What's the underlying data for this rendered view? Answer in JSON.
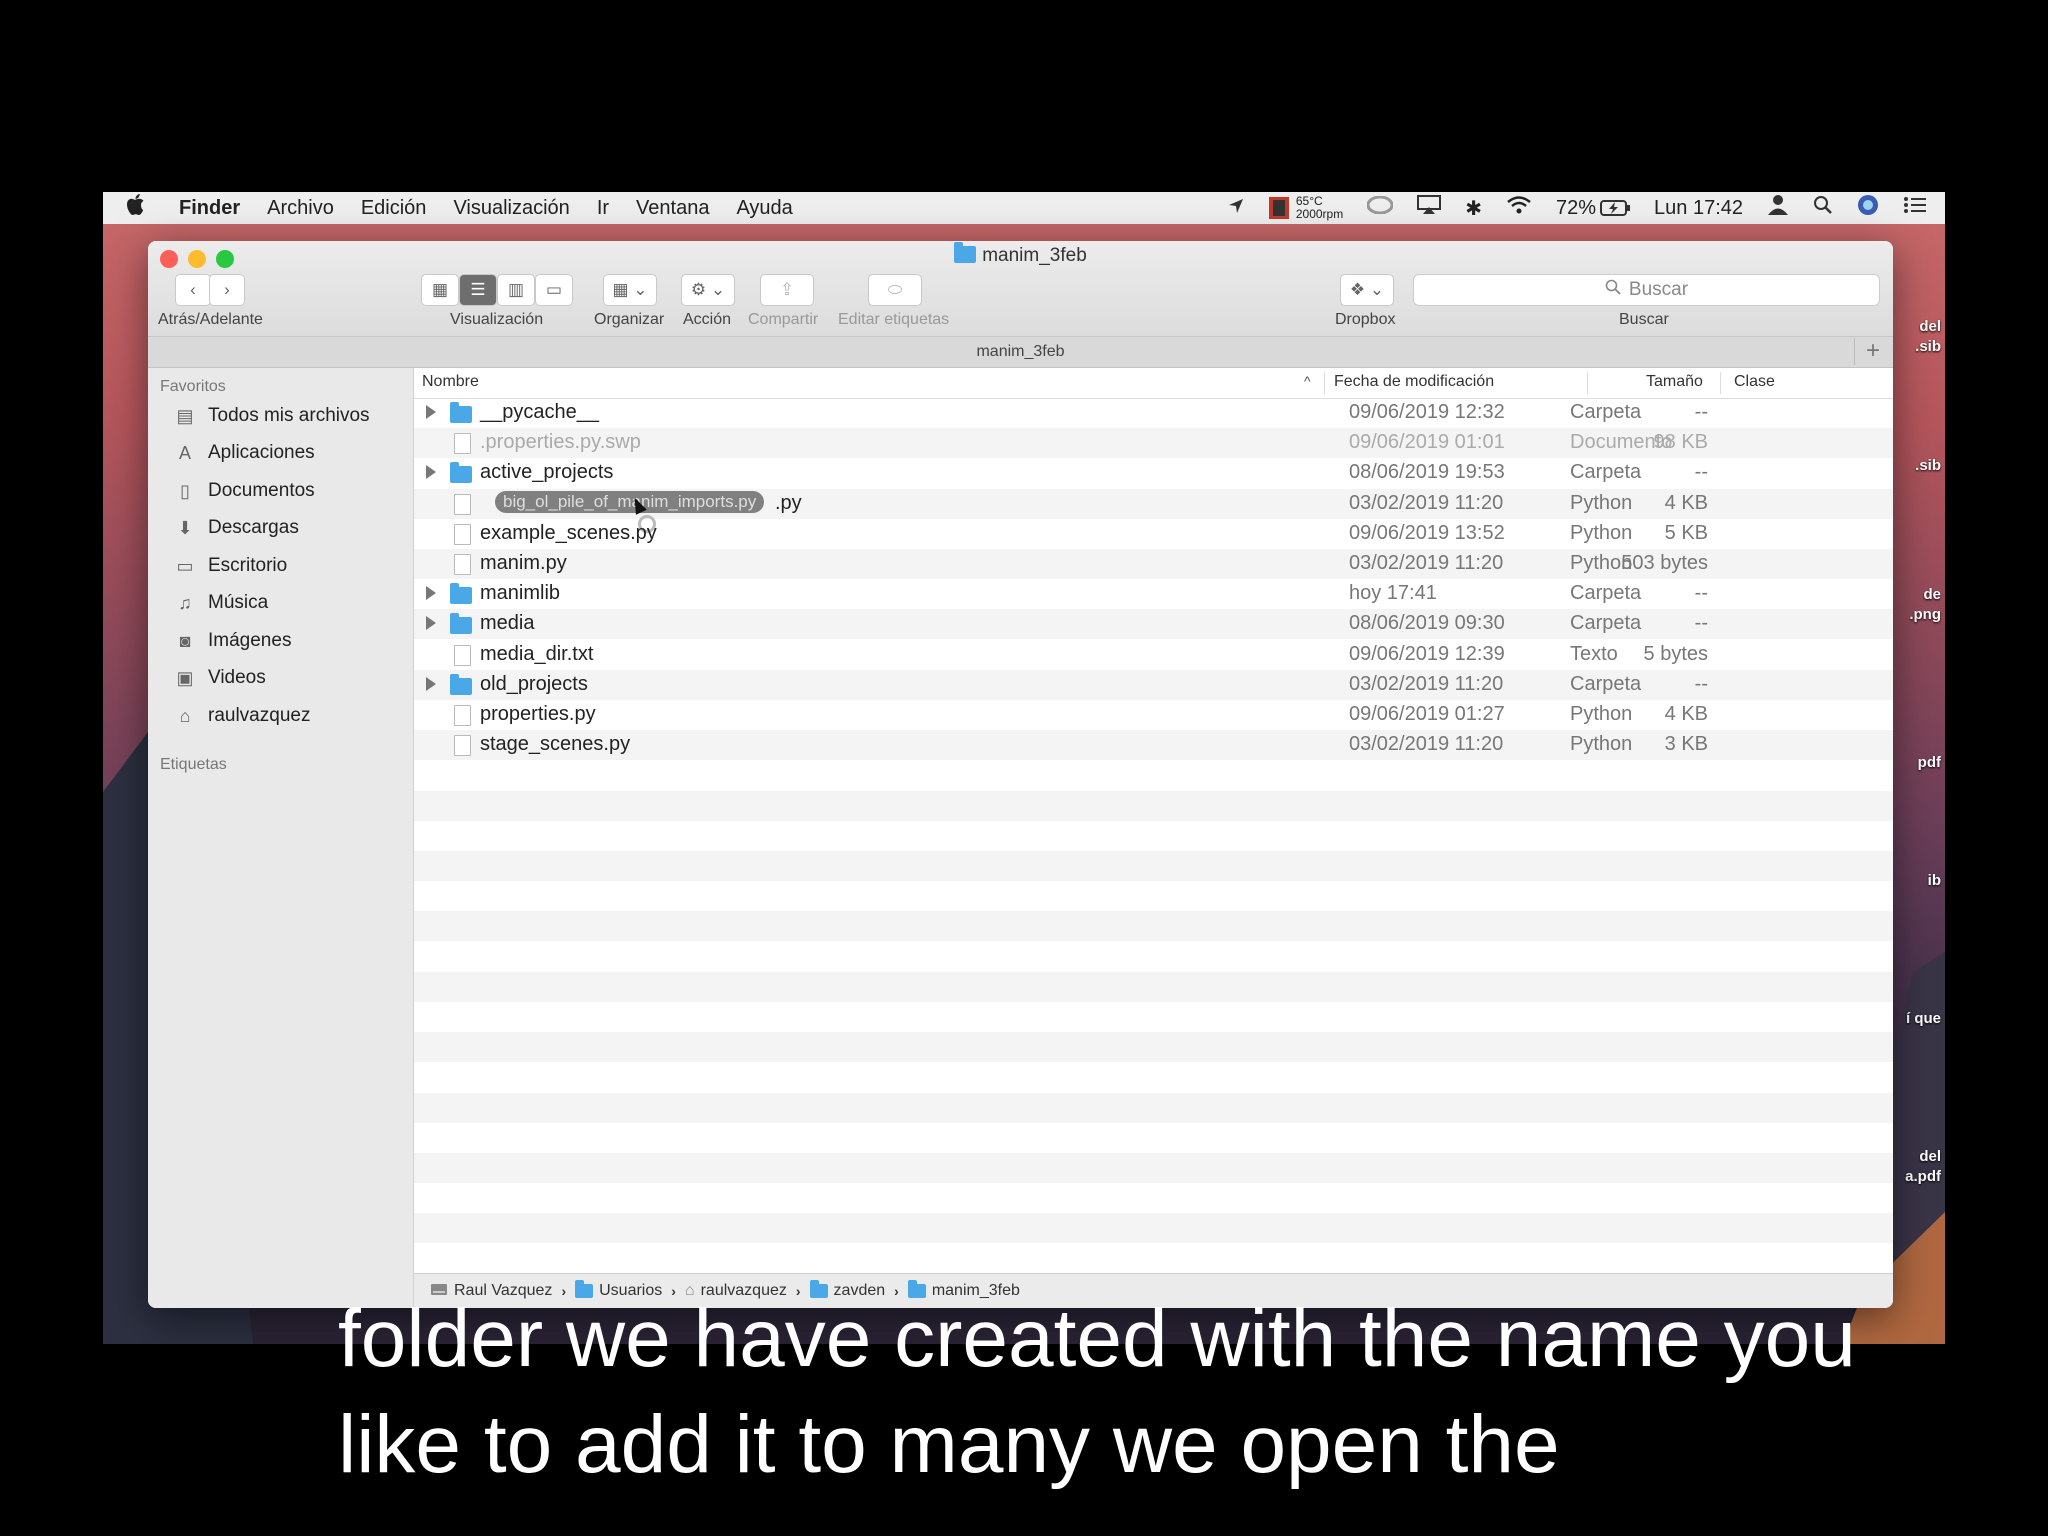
{
  "menubar": {
    "apple": "",
    "items": [
      "Finder",
      "Archivo",
      "Edición",
      "Visualización",
      "Ir",
      "Ventana",
      "Ayuda"
    ],
    "temp": "65°C",
    "rpm": "2000rpm",
    "battery": "72%",
    "clock": "Lun 17:42"
  },
  "window": {
    "title": "manim_3feb",
    "path_title": "manim_3feb"
  },
  "toolbar": {
    "back_forward_label": "Atrás/Adelante",
    "view_label": "Visualización",
    "arrange_label": "Organizar",
    "action_label": "Acción",
    "share_label": "Compartir",
    "tags_label": "Editar etiquetas",
    "dropbox_label": "Dropbox",
    "search_label": "Buscar",
    "search_placeholder": "Buscar"
  },
  "sidebar": {
    "favorites_header": "Favoritos",
    "tags_header": "Etiquetas",
    "items": [
      {
        "label": "Todos mis archivos",
        "icon": "all-files-icon"
      },
      {
        "label": "Aplicaciones",
        "icon": "applications-icon"
      },
      {
        "label": "Documentos",
        "icon": "documents-icon"
      },
      {
        "label": "Descargas",
        "icon": "downloads-icon"
      },
      {
        "label": "Escritorio",
        "icon": "desktop-icon"
      },
      {
        "label": "Música",
        "icon": "music-icon"
      },
      {
        "label": "Imágenes",
        "icon": "pictures-icon"
      },
      {
        "label": "Videos",
        "icon": "movies-icon"
      },
      {
        "label": "raulvazquez",
        "icon": "home-icon"
      }
    ]
  },
  "columns": {
    "name": "Nombre",
    "date": "Fecha de modificación",
    "size": "Tamaño",
    "kind": "Clase"
  },
  "files": [
    {
      "name": "__pycache__",
      "date": "09/06/2019 12:32",
      "size": "--",
      "kind": "Carpeta",
      "folder": true
    },
    {
      "name": ".properties.py.swp",
      "date": "09/06/2019 01:01",
      "size": "98 KB",
      "kind": "Documento",
      "folder": false,
      "dim": true
    },
    {
      "name": "active_projects",
      "date": "08/06/2019 19:53",
      "size": "--",
      "kind": "Carpeta",
      "folder": true
    },
    {
      "name": "big_ol_pile_of_manim_imports.py",
      "date": "03/02/2019 11:20",
      "size": "4 KB",
      "kind": "Python",
      "folder": false
    },
    {
      "name": "example_scenes.py",
      "date": "09/06/2019 13:52",
      "size": "5 KB",
      "kind": "Python",
      "folder": false
    },
    {
      "name": "manim.py",
      "date": "03/02/2019 11:20",
      "size": "503 bytes",
      "kind": "Python",
      "folder": false
    },
    {
      "name": "manimlib",
      "date": "hoy 17:41",
      "size": "--",
      "kind": "Carpeta",
      "folder": true
    },
    {
      "name": "media",
      "date": "08/06/2019 09:30",
      "size": "--",
      "kind": "Carpeta",
      "folder": true
    },
    {
      "name": "media_dir.txt",
      "date": "09/06/2019 12:39",
      "size": "5 bytes",
      "kind": "Texto",
      "folder": false
    },
    {
      "name": "old_projects",
      "date": "03/02/2019 11:20",
      "size": "--",
      "kind": "Carpeta",
      "folder": true
    },
    {
      "name": "properties.py",
      "date": "09/06/2019 01:27",
      "size": "4 KB",
      "kind": "Python",
      "folder": false
    },
    {
      "name": "stage_scenes.py",
      "date": "03/02/2019 11:20",
      "size": "3 KB",
      "kind": "Python",
      "folder": false
    }
  ],
  "drag": {
    "label": "big_ol_pile_of_manim_imports.py",
    "row_suffix": ".py"
  },
  "statusbar": {
    "crumbs": [
      "Raul Vazquez",
      "Usuarios",
      "raulvazquez",
      "zavden",
      "manim_3feb"
    ]
  },
  "desktop_labels": [
    "del",
    ".sib",
    ".sib",
    "de",
    ".png",
    "pdf",
    "ib",
    "í que",
    "del",
    "a.pdf"
  ],
  "subtitles": {
    "line1": "folder we have created with the name you",
    "line2": "like to add it to many we open the"
  }
}
